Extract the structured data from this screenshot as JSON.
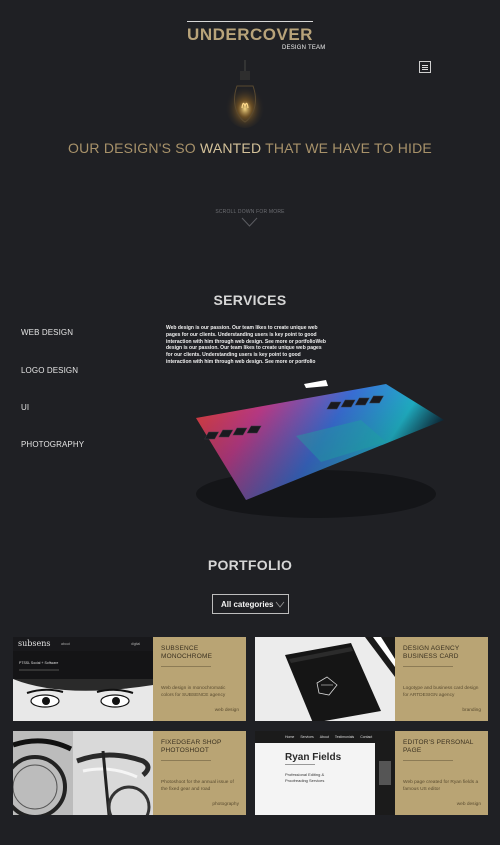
{
  "brand": {
    "title": "UNDERCOVER",
    "subtitle": "DESIGN TEAM"
  },
  "hero": {
    "tagline_before": "OUR DESIGN'S SO ",
    "tagline_highlight": "WANTED",
    "tagline_after": " THAT WE HAVE TO HIDE",
    "scroll_hint": "SCROLL DOWN FOR MORE"
  },
  "services": {
    "title": "SERVICES",
    "items": [
      "WEB DESIGN",
      "LOGO DESIGN",
      "UI",
      "PHOTOGRAPHY"
    ],
    "description": "Web design is our passion. Our team likes to create unique web pages for our clients. Understanding users is key point to good interaction with him through web design. See more or portfolioWeb design is our passion. Our team likes to create unique web pages for our clients. Understanding users is key point to good interaction with him through web design. See more or portfolio"
  },
  "portfolio": {
    "title": "PORTFOLIO",
    "filter_value": "All categories",
    "items": [
      {
        "title": "SUBSENCE MONOCHROME",
        "description": "Web design in monochromatic colors for SUBSENCE agency",
        "category": "web design",
        "thumb_brand": "subsens",
        "thumb_nav": "about",
        "thumb_nav_right": "digital",
        "thumb_heading": "PTSSL Social + Software"
      },
      {
        "title": "DESIGN AGENCY BUSINESS CARD",
        "description": "Logotype and business card design for ARTDESIGN agency",
        "category": "branding"
      },
      {
        "title": "FIXEDGEAR SHOP PHOTOSHOOT",
        "description": "Photoshoot for the annual issue of the fixed gear and road",
        "category": "photography"
      },
      {
        "title": "EDITOR'S PERSONAL PAGE",
        "description": "Web page created for Ryan fields a famous US editor",
        "category": "web design",
        "thumb_nav": [
          "Home",
          "Services",
          "About",
          "Testimonials",
          "Contact"
        ],
        "thumb_name": "Ryan Fields",
        "thumb_tagline": "Professional Editing & Proofreading Services"
      }
    ]
  },
  "colors": {
    "background": "#1f2024",
    "accent": "#b9a474",
    "gold_text": "#a8926a"
  },
  "icons": {
    "menu": "hamburger-menu-icon",
    "scroll": "chevron-down-icon",
    "select": "chevron-down-icon"
  }
}
